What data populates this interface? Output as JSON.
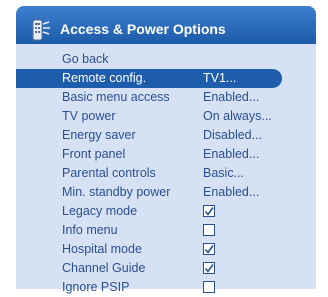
{
  "header": {
    "title": "Access & Power Options",
    "icon": "remote-control-icon"
  },
  "colors": {
    "header_blue": "#1d5dab",
    "panel_bg": "#d6e2f4",
    "text_blue": "#2a4f8f"
  },
  "menu": {
    "items": [
      {
        "label": "Go back",
        "value": "",
        "type": "text",
        "checked": false,
        "selected": false
      },
      {
        "label": "Remote config.",
        "value": "TV1...",
        "type": "text",
        "checked": false,
        "selected": true
      },
      {
        "label": "Basic menu access",
        "value": "Enabled...",
        "type": "text",
        "checked": false,
        "selected": false
      },
      {
        "label": "TV power",
        "value": "On always...",
        "type": "text",
        "checked": false,
        "selected": false
      },
      {
        "label": "Energy saver",
        "value": "Disabled...",
        "type": "text",
        "checked": false,
        "selected": false
      },
      {
        "label": "Front panel",
        "value": "Enabled...",
        "type": "text",
        "checked": false,
        "selected": false
      },
      {
        "label": "Parental controls",
        "value": "Basic...",
        "type": "text",
        "checked": false,
        "selected": false
      },
      {
        "label": "Min. standby power",
        "value": "Enabled...",
        "type": "text",
        "checked": false,
        "selected": false
      },
      {
        "label": "Legacy mode",
        "value": "",
        "type": "checkbox",
        "checked": true,
        "selected": false
      },
      {
        "label": "Info menu",
        "value": "",
        "type": "checkbox",
        "checked": false,
        "selected": false
      },
      {
        "label": "Hospital mode",
        "value": "",
        "type": "checkbox",
        "checked": true,
        "selected": false
      },
      {
        "label": "Channel Guide",
        "value": "",
        "type": "checkbox",
        "checked": true,
        "selected": false
      },
      {
        "label": "Ignore PSIP",
        "value": "",
        "type": "checkbox",
        "checked": false,
        "selected": false
      }
    ]
  }
}
